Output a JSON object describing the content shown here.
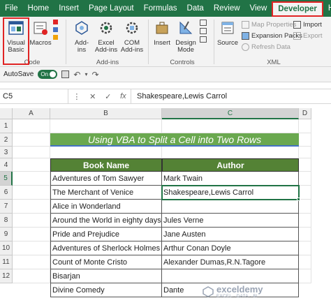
{
  "tabs": [
    "File",
    "Home",
    "Insert",
    "Page Layout",
    "Formulas",
    "Data",
    "Review",
    "View",
    "Developer",
    "Help"
  ],
  "active_tab": "Developer",
  "ribbon": {
    "visual_basic": "Visual\nBasic",
    "visual_basic_l1": "Visual",
    "visual_basic_l2": "Basic",
    "macros": "Macros",
    "addins_l1": "Add-",
    "addins_l2": "ins",
    "excel_addins_l1": "Excel",
    "excel_addins_l2": "Add-ins",
    "com_addins_l1": "COM",
    "com_addins_l2": "Add-ins",
    "insert": "Insert",
    "design_mode_l1": "Design",
    "design_mode_l2": "Mode",
    "source": "Source",
    "map_properties": "Map Properties",
    "expansion_packs": "Expansion Packs",
    "refresh_data": "Refresh Data",
    "import": "Import",
    "export": "Export",
    "groups": {
      "code": "Code",
      "addins": "Add-ins",
      "controls": "Controls",
      "xml": "XML"
    }
  },
  "qat": {
    "autosave_label": "AutoSave",
    "toggle_state": "On"
  },
  "formula_bar": {
    "name_box": "C5",
    "fx": "fx",
    "formula": "Shakespeare,Lewis Carrol"
  },
  "columns": [
    "A",
    "B",
    "C",
    "D"
  ],
  "rows": [
    "1",
    "2",
    "3",
    "4",
    "5",
    "6",
    "7",
    "8",
    "9",
    "10",
    "11",
    "12"
  ],
  "sheet": {
    "title": "Using VBA to Split a Cell into Two Rows",
    "headers": {
      "book": "Book Name",
      "author": "Author"
    },
    "books": [
      "Adventures of Tom Sawyer",
      "The Merchant of Venice",
      "Alice in Wonderland",
      "Around the World in eighty days",
      "Pride and Prejudice",
      "Adventures of Sherlock Holmes",
      "Count of Monte Cristo",
      "Bisarjan",
      "Divine Comedy"
    ],
    "authors": [
      "Mark Twain",
      "Shakespeare,Lewis Carrol",
      "",
      "Jules Verne",
      "Jane Austen",
      "Arthur Conan Doyle",
      "Alexander Dumas,R.N.Tagore",
      "",
      "Dante"
    ]
  },
  "watermark": {
    "name": "exceldemy",
    "sub": "EXCEL · DATA · BI"
  },
  "colors": {
    "excel_green": "#217346",
    "title_green": "#6aa84f",
    "header_green": "#548235",
    "highlight_red": "#e02424"
  }
}
